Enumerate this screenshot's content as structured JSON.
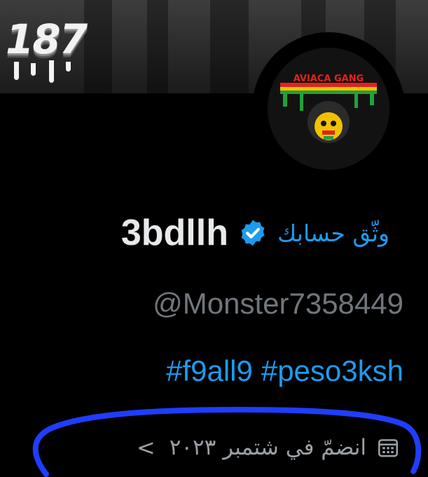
{
  "banner": {
    "text": "187"
  },
  "profile": {
    "name": "3bdllh",
    "verify_link": "وثّق حسابك",
    "handle": "@Monster7358449",
    "bio_hashtags": [
      "#f9all9",
      "#peso3ksh"
    ],
    "joined": "انضمّ في شتمبر ٢٠٢٣",
    "chevron": "<"
  },
  "avatar": {
    "logo_text": "AVIACA GANG"
  },
  "colors": {
    "background": "#000000",
    "accent": "#1d9bf0",
    "name": "#e7e9ea",
    "muted": "#71767b",
    "annotation": "#1f3dff"
  },
  "icons": [
    "verified-badge-icon",
    "calendar-icon",
    "chevron-left-icon"
  ]
}
